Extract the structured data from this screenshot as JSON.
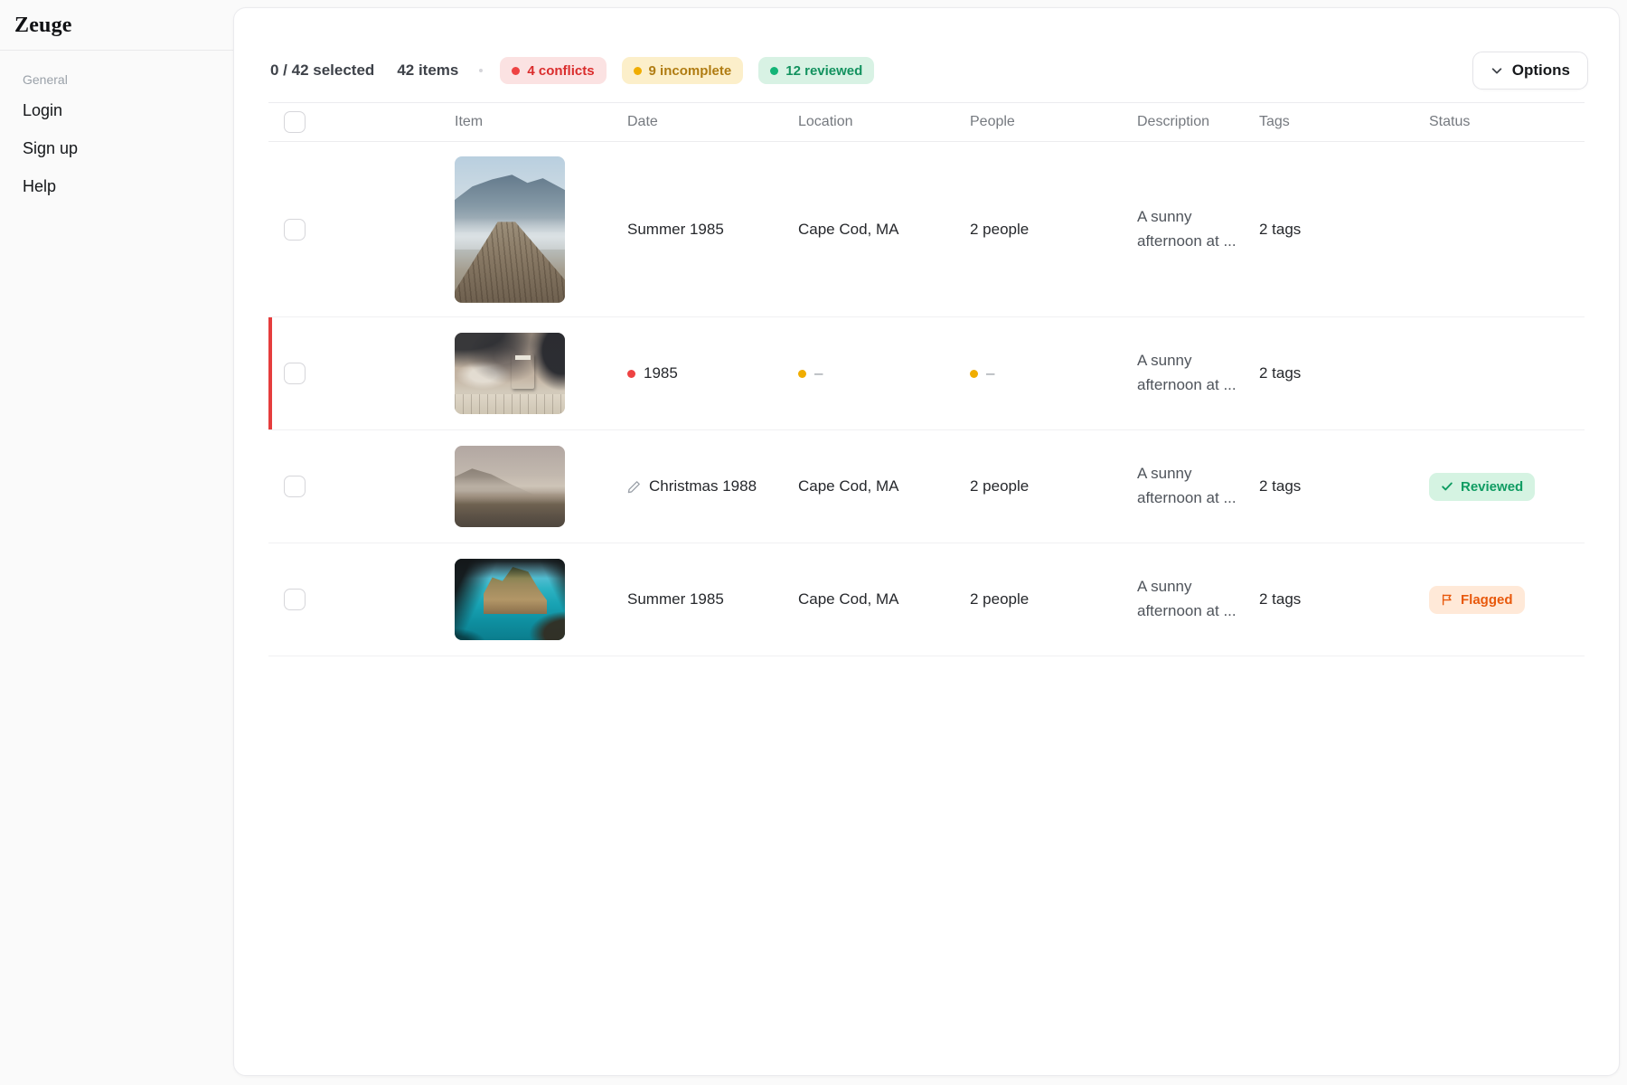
{
  "app": {
    "name": "Zeuge"
  },
  "sidebar": {
    "section_label": "General",
    "items": [
      {
        "label": "Login"
      },
      {
        "label": "Sign up"
      },
      {
        "label": "Help"
      }
    ]
  },
  "toolbar": {
    "selected_text": "0 / 42 selected",
    "items_text": "42 items",
    "badges": [
      {
        "label": "4 conflicts",
        "type": "conflicts",
        "text_color": "#da2c2c",
        "bg_color": "#fbe2e2",
        "dot_color": "#ee4343"
      },
      {
        "label": "9 incomplete",
        "type": "incomplete",
        "text_color": "#b07c12",
        "bg_color": "#fcefca",
        "dot_color": "#f0ad00"
      },
      {
        "label": "12 reviewed",
        "type": "reviewed",
        "text_color": "#13925f",
        "bg_color": "#d8f2e4",
        "dot_color": "#12b477"
      }
    ],
    "options_label": "Options"
  },
  "table": {
    "columns": [
      "Item",
      "Date",
      "Location",
      "People",
      "Description",
      "Tags",
      "Status"
    ],
    "rows": [
      {
        "thumb": "wooden-pier-lake-mountains",
        "date": "Summer 1985",
        "location": "Cape Cod, MA",
        "people": "2 people",
        "description": "A sunny afternoon at ...",
        "tags": "2 tags",
        "status": "unreviewed-dot"
      },
      {
        "conflict_row": true,
        "thumb": "red-postbox-on-wall",
        "date": "1985",
        "date_indicator": "red-dot",
        "location": "–",
        "location_indicator": "yellow-dot",
        "people": "–",
        "people_indicator": "yellow-dot",
        "description": "A sunny afternoon at ...",
        "tags": "2 tags",
        "status": "unreviewed-dot"
      },
      {
        "thumb": "foggy-hill-field",
        "date": "Christmas 1988",
        "date_icon": "pencil-icon",
        "location": "Cape Cod, MA",
        "people": "2 people",
        "description": "A sunny afternoon at ...",
        "tags": "2 tags",
        "status": "reviewed",
        "status_label": "Reviewed"
      },
      {
        "thumb": "sea-cove-cliffs",
        "date": "Summer 1985",
        "location": "Cape Cod, MA",
        "people": "2 people",
        "description": "A sunny afternoon at ...",
        "tags": "2 tags",
        "status": "flagged",
        "status_label": "Flagged"
      }
    ]
  }
}
